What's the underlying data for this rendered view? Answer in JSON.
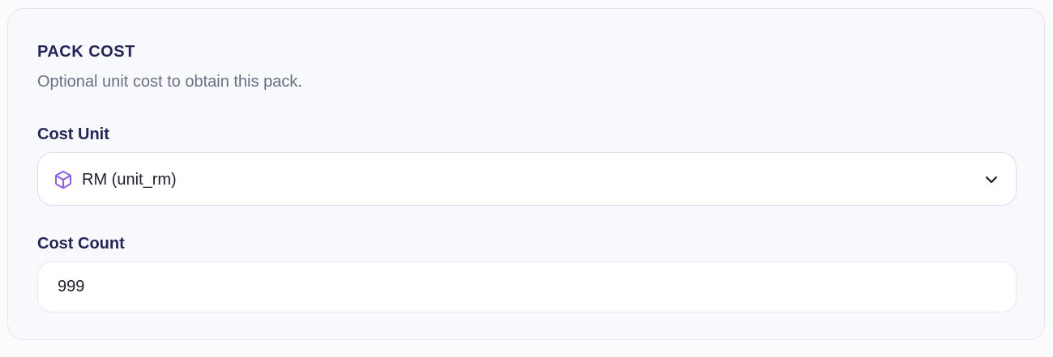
{
  "section": {
    "title": "PACK COST",
    "description": "Optional unit cost to obtain this pack."
  },
  "cost_unit": {
    "label": "Cost Unit",
    "selected": "RM (unit_rm)",
    "icon": "cube-icon",
    "icon_color": "#8b5cf6"
  },
  "cost_count": {
    "label": "Cost Count",
    "value": "999"
  },
  "colors": {
    "heading": "#25245a",
    "muted_text": "#6b7083",
    "accent": "#8b5cf6"
  }
}
